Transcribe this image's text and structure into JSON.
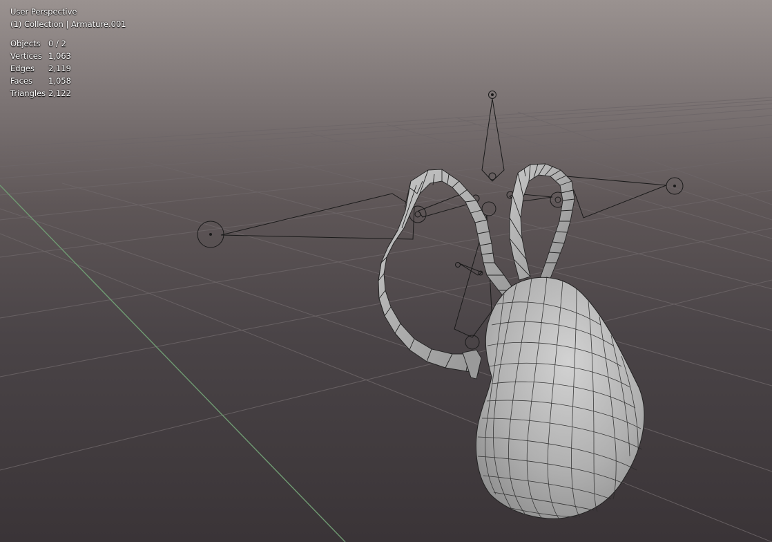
{
  "viewport": {
    "view_name": "User Perspective",
    "collection_line": "(1) Collection | Armature.001",
    "stats": [
      {
        "label": "Objects",
        "value": "0 / 2"
      },
      {
        "label": "Vertices",
        "value": "1,063"
      },
      {
        "label": "Edges",
        "value": "2,119"
      },
      {
        "label": "Faces",
        "value": "1,058"
      },
      {
        "label": "Triangles",
        "value": "2,122"
      }
    ]
  },
  "colors": {
    "bg_top": "#9a9290",
    "bg_bottom": "#3a3437",
    "grid_line": "#6d6668",
    "y_axis": "#6f9a72",
    "mesh_fill": "#b4b4b4",
    "wire": "#1e1e1e"
  },
  "icons": [
    "bone-icon",
    "mesh-object-icon"
  ]
}
